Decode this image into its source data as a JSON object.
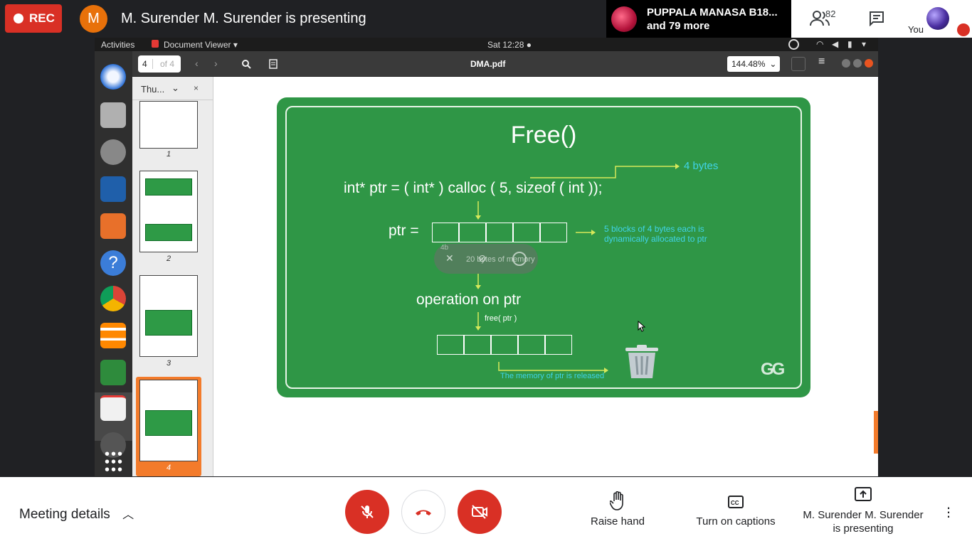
{
  "meet_top": {
    "rec_label": "REC",
    "presenter_initial": "M",
    "presenter_title": "M. Surender M. Surender is presenting",
    "participant_name": "PUPPALA MANASA B18...",
    "participant_more": "and 79 more",
    "people_count": "82",
    "you_label": "You"
  },
  "screen": {
    "activities": "Activities",
    "app_menu": "Document Viewer ▾",
    "clock": "Sat 12:28 ●",
    "viewer": {
      "page_current": "4",
      "page_total": "of 4",
      "title": "DMA.pdf",
      "zoom": "144.48%",
      "sidebar_mode": "Thu...",
      "thumbnails": [
        "1",
        "2",
        "3",
        "4"
      ]
    },
    "slide": {
      "title": "Free()",
      "code": "int* ptr = ( int* ) calloc ( 5, sizeof ( int ));",
      "bytes_note": "4 bytes",
      "ptr_label": "ptr =",
      "alloc_note_1": "5 blocks of 4 bytes each is",
      "alloc_note_2": "dynamically allocated to ptr",
      "small_4b": "4b",
      "memory_note": "20 bytes of memory",
      "operation": "operation on ptr",
      "free_call": "free( ptr )",
      "released_note": "The memory of ptr is released",
      "logo": "GG"
    }
  },
  "meet_bottom": {
    "meeting_details": "Meeting details",
    "raise_hand": "Raise hand",
    "captions": "Turn on captions",
    "presenting_line1": "M. Surender M. Surender",
    "presenting_line2": "is presenting"
  },
  "colors": {
    "rec_red": "#d93025",
    "slide_green": "#2f9646",
    "accent_orange": "#f37b2b",
    "cyan": "#40d4e8"
  }
}
